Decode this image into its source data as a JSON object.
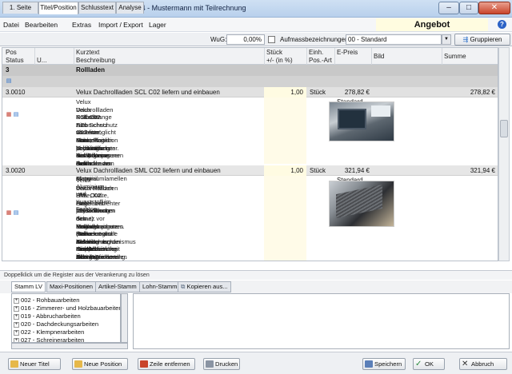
{
  "window": {
    "title": "Angebot 14-ANG-2107 von 14-PR-1004 - Mustermann mit Teilrechnung",
    "min": "–",
    "max": "□",
    "close": "✕"
  },
  "menu": {
    "items": [
      "Datei",
      "Bearbeiten",
      "Extras",
      "Import / Export",
      "Lager"
    ],
    "doc_type": "Angebot"
  },
  "tabs": {
    "items": [
      "1. Seite",
      "Titel/Position",
      "Schlusstext",
      "Analyse"
    ],
    "active": 1
  },
  "toolbar": {
    "wug_label": "WuG:",
    "wug_value": "0,00%",
    "aufmass_label": "Aufmassbezeichnungen:",
    "aufmass_value": "00 - Standard",
    "group_button": "Gruppieren"
  },
  "grid": {
    "headers": {
      "pos": "Pos",
      "status": "Status",
      "u": "U...",
      "kurztext": "Kurztext",
      "beschreibung": "Beschreibung",
      "stueck": "Stück",
      "plusminus": "+/- (in %)",
      "einh": "Einh.",
      "posart": "Pos.-Art",
      "epreis": "E-Preis",
      "bild": "Bild",
      "summe": "Summe"
    },
    "group": {
      "pos": "3",
      "title": "Rollladen"
    },
    "rows": [
      {
        "pos": "3.0010",
        "kurztext": "Velux Dachrollladen SCL C02 liefern und einbauen",
        "stueck": "1,00",
        "einh": "Stück",
        "epreis": "278,82 €",
        "summe": "278,82 €",
        "art": "Standard",
        "langtext": [
          "Velux Dachrollladen SCL C02",
          "Velux Rollladen SCL C02. Manuell bedienter Rollladen durch eine",
          "Kurbelstange zum Schutz vor Hitze, Kälte, Hagel und Lärm. Dient dem",
          "Einbruchschutz und ermöglicht eine Verdunklung des Raumes (keine",
          "absolute Dunkelheit im physikalischen Sinn). Keine Behinderung der",
          "Fensterfunktion bei heraufgezogenen Rollladen am Schwing- bzw. Klapp-",
          "Schwingfenster. Rollladenpanzer aus ausgeschäumten Aluminiumlamellen",
          "in Gummikedern gelagert. Material: Aluminium und Kunststoff im Farbton",
          "der Fensterabdeckung."
        ]
      },
      {
        "pos": "3.0020",
        "kurztext": "Velux Dachrollladen SML C02 liefern und einbauen",
        "stueck": "1,00",
        "einh": "Stück",
        "epreis": "321,94 €",
        "summe": "321,94 €",
        "art": "Standard",
        "langtext": [
          "Velux Dachrollladen SML C02",
          "Velux Rollladen SML C02. Elektrobedienter Rollladen zum Schutz vor",
          "Hitze, Kälte, Hagel und Lärm. Dient dem Einbruchschutz und ermöglicht",
          "eine Verdunklung des Raumes (keine absolute Dunkelheit im",
          "physikalischen Sinne). Möglichkeit der elektrischen stufenlosen Öffnung",
          "des Rollladenpanzers. Keine Behinderung der Fensterfunktion bei",
          "heraufgezogenen Rollladen am Schwing- bzw. Klapp-Schwingfenster.",
          "(Steuerzentrale inkl. Fernbedienung sind gesondert zu bestellen.)",
          "Antriebsmechanismus mit elektrischer Überlastsicherung. Nennspannung",
          "der Motoreinheit 24 V DC. Rollladenpanzer aus ausgeschäumten",
          "Aluminiumlamellen in Gummikedern gelagert. Material: Aluminium und",
          "Kunststoff im Farbton der Fensterabdeckung."
        ]
      }
    ]
  },
  "lower": {
    "hint": "Doppelklick um die Register aus der Verankerung zu lösen",
    "tabs": [
      "Stamm LV",
      "Maxi-Positionen",
      "Artikel-Stamm",
      "Lohn-Stamm",
      "Kopieren aus..."
    ],
    "tree": [
      "002 - Rohbauarbeiten",
      "016 - Zimmerer- und Holzbauarbeiten",
      "019 - Abbrucharbeiten",
      "020 - Dachdeckungsarbeiten",
      "022 - Klempnerarbeiten",
      "027 - Schreinerarbeiten"
    ]
  },
  "footer": {
    "new_title": "Neuer Titel",
    "new_position": "Neue Position",
    "remove_row": "Zeile entfernen",
    "print": "Drucken",
    "save": "Speichern",
    "ok": "OK",
    "cancel": "Abbruch"
  },
  "colors": {
    "accent": "#2a6fc9",
    "yellow": "#fffbe2",
    "group_bg": "#c8c8c8"
  }
}
